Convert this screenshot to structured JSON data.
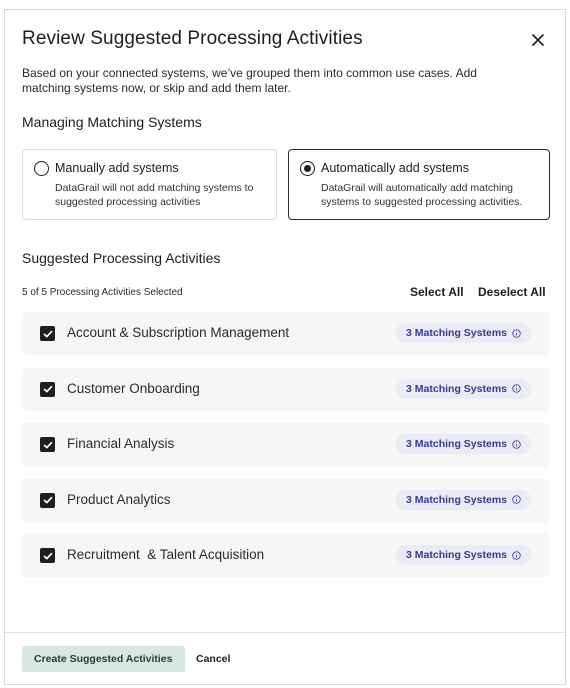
{
  "modal": {
    "title": "Review Suggested Processing Activities",
    "description": "Based on your connected systems, we’ve grouped them into common use cases. Add matching systems now, or skip and add them later."
  },
  "matching": {
    "section_title": "Managing Matching Systems",
    "options": [
      {
        "label": "Manually add systems",
        "description": "DataGrail will not add matching systems to suggested processing activities",
        "selected": false
      },
      {
        "label": "Automatically add systems",
        "description": "DataGrail will automatically add matching systems to suggested processing activities.",
        "selected": true
      }
    ]
  },
  "activities": {
    "section_title": "Suggested Processing Activities",
    "count_text": "5 of 5 Processing Activities Selected",
    "select_all": "Select All",
    "deselect_all": "Deselect All",
    "items": [
      {
        "name": "Account & Subscription Management",
        "badge": "3 Matching Systems",
        "checked": true
      },
      {
        "name": "Customer Onboarding",
        "badge": "3 Matching Systems",
        "checked": true
      },
      {
        "name": "Financial Analysis",
        "badge": "3 Matching Systems",
        "checked": true
      },
      {
        "name": "Product Analytics",
        "badge": "3 Matching Systems",
        "checked": true
      },
      {
        "name": "Recruitment  & Talent Acquisition",
        "badge": "3 Matching Systems",
        "checked": true
      }
    ]
  },
  "footer": {
    "primary_label": "Create Suggested Activities",
    "cancel_label": "Cancel"
  },
  "icons": {
    "close": "close-icon",
    "info": "info-icon",
    "check": "checkmark-icon"
  },
  "colors": {
    "badge_bg": "#ebeaf7",
    "badge_text": "#3a3b8a",
    "primary_btn_bg": "#d8e7e2",
    "row_bg": "#f6f6f6"
  }
}
